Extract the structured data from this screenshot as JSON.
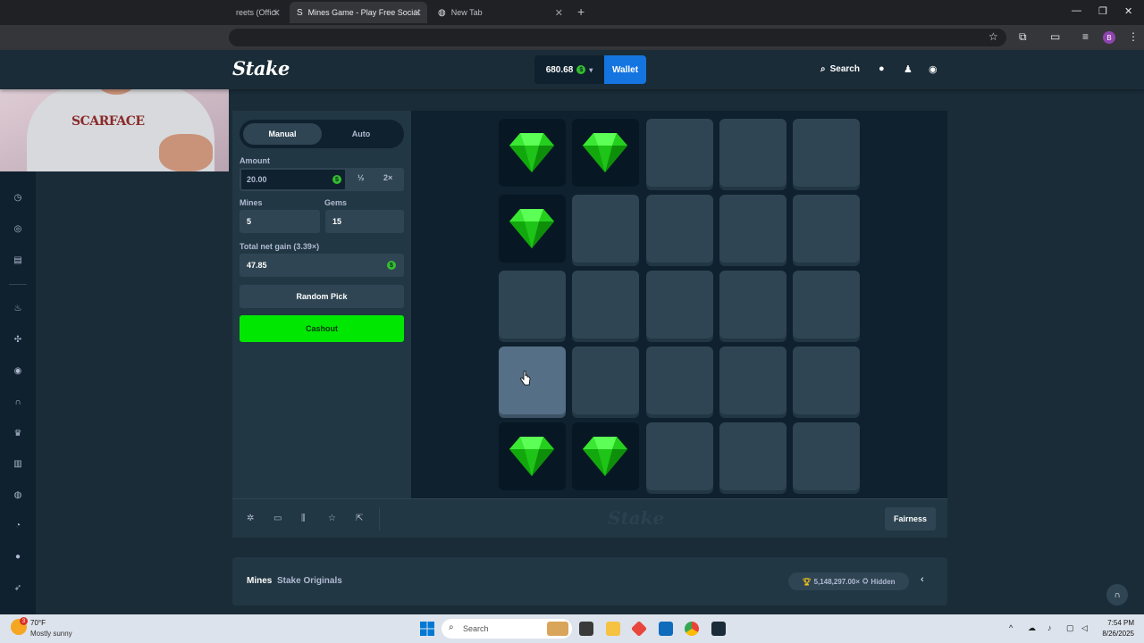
{
  "browser": {
    "tabs": [
      {
        "title": "reets (Offici",
        "active": false
      },
      {
        "title": "Mines Game - Play Free Social",
        "active": true
      },
      {
        "title": "New Tab",
        "active": false
      }
    ],
    "new_tab_glyph": "+",
    "profile_initial": "B"
  },
  "header": {
    "logo": "Stake",
    "balance": "680.68",
    "currency_glyph": "$",
    "wallet_label": "Wallet",
    "search_label": "Search"
  },
  "webcam": {
    "shirt_text": "SCARFACE"
  },
  "controls": {
    "tabs": [
      "Manual",
      "Auto"
    ],
    "selected_tab": "Manual",
    "amount_label": "Amount",
    "amount_value": "20.00",
    "half_label": "½",
    "double_label": "2×",
    "mines_label": "Mines",
    "mines_value": "5",
    "gems_label": "Gems",
    "gems_value": "15",
    "net_gain_label": "Total net gain (3.39×)",
    "net_gain_value": "47.85",
    "random_pick_label": "Random Pick",
    "cashout_label": "Cashout"
  },
  "board": {
    "rows": 5,
    "cols": 5,
    "revealed_gems": [
      [
        0,
        0
      ],
      [
        0,
        1
      ],
      [
        1,
        0
      ],
      [
        4,
        0
      ],
      [
        4,
        1
      ]
    ],
    "hovered_tile": [
      3,
      0
    ]
  },
  "footer": {
    "logo": "Stake",
    "fairness_label": "Fairness"
  },
  "info": {
    "game_title": "Mines",
    "game_subtitle": "Stake Originals",
    "max_win": "5,148,297.00×",
    "hidden_label": "Hidden"
  },
  "taskbar": {
    "weather_temp": "70°F",
    "weather_desc": "Mostly sunny",
    "weather_badge": "3",
    "search_placeholder": "Search",
    "time": "7:54 PM",
    "date": "8/26/2025"
  },
  "colors": {
    "bg": "#1a2c38",
    "panel": "#213743",
    "tile": "#2f4553",
    "board": "#0f212e",
    "accent_green": "#00e701",
    "wallet_blue": "#1475e1",
    "gem_green": "#21d41a"
  }
}
